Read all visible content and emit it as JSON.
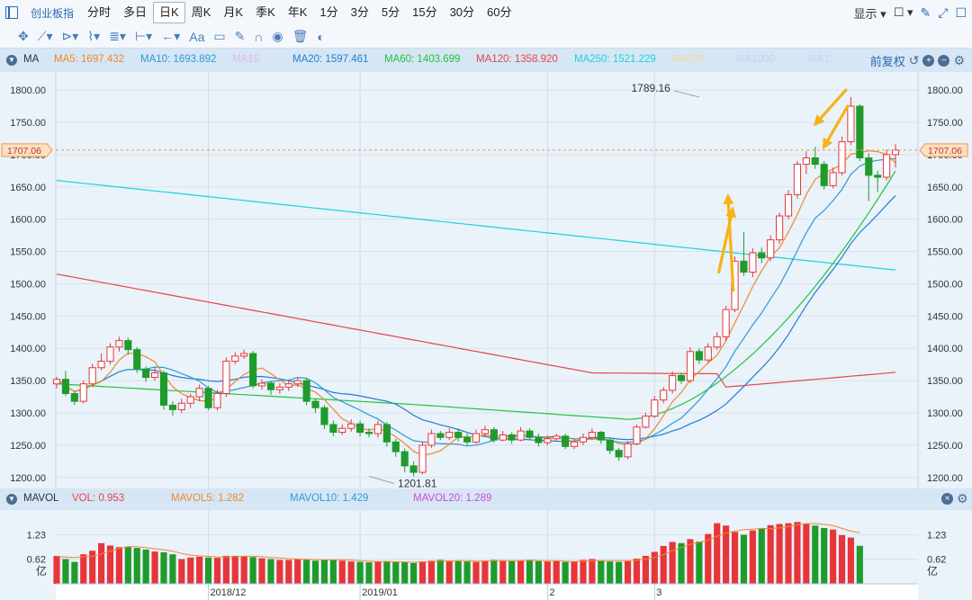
{
  "toolbar": {
    "name": "创业板指",
    "periods": [
      "分时",
      "多日",
      "日K",
      "周K",
      "月K",
      "季K",
      "年K",
      "1分",
      "3分",
      "5分",
      "15分",
      "30分",
      "60分"
    ],
    "active_period": "日K",
    "display_label": "显示"
  },
  "draw_tools": [
    "move-icon",
    "line-icon",
    "ray-icon",
    "polyline-icon",
    "fib-icon",
    "range-icon",
    "arrow-icon",
    "text-icon",
    "comment-icon",
    "pen-icon",
    "magnet-icon",
    "eye-icon",
    "trash-icon",
    "link-icon"
  ],
  "ma_legend": {
    "title": "MA",
    "items": [
      {
        "label": "MA5: 1697.432",
        "color": "#f0882c"
      },
      {
        "label": "MA10: 1693.892",
        "color": "#2c9bd2"
      },
      {
        "label": "MA15:",
        "color": "#e2b5f0"
      },
      {
        "label": "MA20: 1597.461",
        "color": "#1e7fd0"
      },
      {
        "label": "MA60: 1403.699",
        "color": "#22c43a"
      },
      {
        "label": "MA120: 1358.920",
        "color": "#e84545"
      },
      {
        "label": "MA250: 1521.229",
        "color": "#19d3da"
      },
      {
        "label": "MA500:",
        "color": "#f3d7a3"
      },
      {
        "label": "MA1000:",
        "color": "#c9d2f2"
      },
      {
        "label": "MA1:",
        "color": "#c9d2f2"
      }
    ],
    "adjust_label": "前复权"
  },
  "vol_legend": {
    "title": "MAVOL",
    "items": [
      {
        "label": "VOL: 0.953",
        "color": "#e84545"
      },
      {
        "label": "MAVOL5: 1.282",
        "color": "#f0882c"
      },
      {
        "label": "MAVOL10: 1.429",
        "color": "#2c9bd2"
      },
      {
        "label": "MAVOL20: 1.289",
        "color": "#d04ad0"
      }
    ]
  },
  "chart_data": {
    "type": "candlestick",
    "y_ticks": [
      1800.0,
      1750.0,
      1700.0,
      1650.0,
      1600.0,
      1550.0,
      1500.0,
      1450.0,
      1400.0,
      1350.0,
      1300.0,
      1250.0,
      1200.0
    ],
    "ylim": [
      1183,
      1828
    ],
    "current_price": "1707.06",
    "annotations": [
      {
        "text": "1789.16",
        "value": 1789.16,
        "index": 72
      },
      {
        "text": "1201.81",
        "value": 1201.81,
        "index": 35
      }
    ],
    "x_labels": [
      {
        "label": "2018/12",
        "index": 17
      },
      {
        "label": "2019/01",
        "index": 34
      },
      {
        "label": "2",
        "index": 55
      },
      {
        "label": "3",
        "index": 67
      }
    ],
    "candles": [
      [
        1345,
        1352,
        1356,
        1338
      ],
      [
        1352,
        1330,
        1365,
        1326
      ],
      [
        1330,
        1318,
        1334,
        1312
      ],
      [
        1318,
        1345,
        1350,
        1315
      ],
      [
        1345,
        1370,
        1376,
        1340
      ],
      [
        1370,
        1380,
        1392,
        1366
      ],
      [
        1380,
        1402,
        1408,
        1375
      ],
      [
        1402,
        1412,
        1418,
        1395
      ],
      [
        1412,
        1398,
        1416,
        1390
      ],
      [
        1398,
        1368,
        1402,
        1362
      ],
      [
        1368,
        1355,
        1372,
        1348
      ],
      [
        1355,
        1362,
        1370,
        1350
      ],
      [
        1362,
        1312,
        1365,
        1305
      ],
      [
        1312,
        1305,
        1318,
        1296
      ],
      [
        1305,
        1315,
        1322,
        1300
      ],
      [
        1315,
        1325,
        1330,
        1308
      ],
      [
        1325,
        1338,
        1344,
        1318
      ],
      [
        1338,
        1308,
        1342,
        1304
      ],
      [
        1308,
        1330,
        1336,
        1304
      ],
      [
        1330,
        1380,
        1386,
        1325
      ],
      [
        1380,
        1388,
        1394,
        1375
      ],
      [
        1388,
        1392,
        1398,
        1384
      ],
      [
        1392,
        1342,
        1396,
        1338
      ],
      [
        1342,
        1346,
        1352,
        1336
      ],
      [
        1346,
        1336,
        1350,
        1328
      ],
      [
        1336,
        1340,
        1346,
        1330
      ],
      [
        1340,
        1345,
        1350,
        1334
      ],
      [
        1345,
        1350,
        1355,
        1340
      ],
      [
        1350,
        1318,
        1354,
        1312
      ],
      [
        1318,
        1308,
        1322,
        1300
      ],
      [
        1308,
        1282,
        1312,
        1275
      ],
      [
        1282,
        1270,
        1288,
        1264
      ],
      [
        1270,
        1276,
        1282,
        1266
      ],
      [
        1276,
        1283,
        1290,
        1271
      ],
      [
        1283,
        1270,
        1288,
        1264
      ],
      [
        1270,
        1268,
        1276,
        1262
      ],
      [
        1268,
        1282,
        1288,
        1262
      ],
      [
        1282,
        1255,
        1286,
        1248
      ],
      [
        1255,
        1240,
        1260,
        1232
      ],
      [
        1240,
        1218,
        1245,
        1208
      ],
      [
        1218,
        1208,
        1225,
        1201.81
      ],
      [
        1208,
        1250,
        1256,
        1205
      ],
      [
        1250,
        1268,
        1274,
        1246
      ],
      [
        1268,
        1262,
        1272,
        1258
      ],
      [
        1262,
        1270,
        1276,
        1258
      ],
      [
        1270,
        1262,
        1276,
        1256
      ],
      [
        1262,
        1255,
        1268,
        1250
      ],
      [
        1255,
        1268,
        1274,
        1252
      ],
      [
        1268,
        1274,
        1280,
        1264
      ],
      [
        1274,
        1258,
        1278,
        1254
      ],
      [
        1258,
        1266,
        1272,
        1256
      ],
      [
        1266,
        1258,
        1270,
        1252
      ],
      [
        1258,
        1272,
        1278,
        1256
      ],
      [
        1272,
        1262,
        1276,
        1258
      ],
      [
        1262,
        1254,
        1268,
        1248
      ],
      [
        1254,
        1260,
        1265,
        1250
      ],
      [
        1260,
        1264,
        1268,
        1256
      ],
      [
        1264,
        1248,
        1268,
        1244
      ],
      [
        1248,
        1255,
        1260,
        1244
      ],
      [
        1255,
        1262,
        1268,
        1250
      ],
      [
        1262,
        1270,
        1276,
        1258
      ],
      [
        1270,
        1258,
        1272,
        1252
      ],
      [
        1258,
        1242,
        1262,
        1236
      ],
      [
        1242,
        1232,
        1246,
        1226
      ],
      [
        1232,
        1252,
        1256,
        1228
      ],
      [
        1252,
        1278,
        1282,
        1250
      ],
      [
        1278,
        1295,
        1300,
        1276
      ],
      [
        1295,
        1320,
        1326,
        1292
      ],
      [
        1320,
        1335,
        1340,
        1315
      ],
      [
        1335,
        1358,
        1364,
        1330
      ],
      [
        1358,
        1350,
        1362,
        1345
      ],
      [
        1350,
        1395,
        1402,
        1346
      ],
      [
        1395,
        1382,
        1400,
        1376
      ],
      [
        1382,
        1402,
        1408,
        1378
      ],
      [
        1402,
        1418,
        1425,
        1398
      ],
      [
        1418,
        1460,
        1466,
        1412
      ],
      [
        1460,
        1535,
        1542,
        1456
      ],
      [
        1535,
        1518,
        1580,
        1512
      ],
      [
        1518,
        1548,
        1555,
        1510
      ],
      [
        1548,
        1540,
        1556,
        1532
      ],
      [
        1540,
        1568,
        1575,
        1535
      ],
      [
        1568,
        1605,
        1610,
        1562
      ],
      [
        1605,
        1638,
        1645,
        1600
      ],
      [
        1638,
        1685,
        1690,
        1632
      ],
      [
        1685,
        1695,
        1705,
        1670
      ],
      [
        1695,
        1685,
        1712,
        1678
      ],
      [
        1685,
        1652,
        1690,
        1646
      ],
      [
        1652,
        1672,
        1680,
        1648
      ],
      [
        1672,
        1720,
        1728,
        1668
      ],
      [
        1720,
        1775,
        1789.16,
        1715
      ],
      [
        1775,
        1695,
        1778,
        1690
      ],
      [
        1695,
        1668,
        1702,
        1628
      ],
      [
        1668,
        1665,
        1675,
        1642
      ],
      [
        1665,
        1700,
        1708,
        1660
      ],
      [
        1700,
        1707,
        1716,
        1680
      ]
    ],
    "volume": {
      "y_ticks": [
        "1.23",
        "0.62"
      ],
      "unit": "亿",
      "ylim": [
        0,
        1.85
      ],
      "values": [
        0.7,
        0.62,
        0.55,
        0.74,
        0.83,
        1.02,
        0.96,
        0.92,
        0.93,
        0.9,
        0.86,
        0.81,
        0.79,
        0.74,
        0.62,
        0.66,
        0.68,
        0.66,
        0.65,
        0.7,
        0.7,
        0.69,
        0.67,
        0.64,
        0.62,
        0.6,
        0.6,
        0.62,
        0.62,
        0.58,
        0.6,
        0.61,
        0.58,
        0.56,
        0.55,
        0.54,
        0.56,
        0.57,
        0.55,
        0.54,
        0.52,
        0.56,
        0.58,
        0.6,
        0.58,
        0.57,
        0.56,
        0.55,
        0.58,
        0.6,
        0.59,
        0.57,
        0.59,
        0.6,
        0.57,
        0.56,
        0.57,
        0.55,
        0.56,
        0.6,
        0.62,
        0.58,
        0.56,
        0.55,
        0.57,
        0.63,
        0.7,
        0.8,
        0.95,
        1.05,
        1.02,
        1.12,
        1.06,
        1.25,
        1.52,
        1.46,
        1.3,
        1.23,
        1.34,
        1.38,
        1.47,
        1.5,
        1.52,
        1.55,
        1.5,
        1.46,
        1.4,
        1.36,
        1.22,
        1.16,
        0.953
      ],
      "mavol5": [
        0.68,
        0.67,
        0.66,
        0.68,
        0.69,
        0.75,
        0.82,
        0.89,
        0.93,
        0.93,
        0.91,
        0.88,
        0.85,
        0.82,
        0.76,
        0.72,
        0.7,
        0.69,
        0.67,
        0.67,
        0.68,
        0.69,
        0.69,
        0.68,
        0.66,
        0.65,
        0.63,
        0.62,
        0.61,
        0.61,
        0.6,
        0.6,
        0.6,
        0.59,
        0.58,
        0.57,
        0.56,
        0.56,
        0.55,
        0.55,
        0.54,
        0.55,
        0.56,
        0.57,
        0.57,
        0.58,
        0.58,
        0.57,
        0.57,
        0.58,
        0.58,
        0.58,
        0.58,
        0.59,
        0.58,
        0.58,
        0.58,
        0.57,
        0.56,
        0.57,
        0.58,
        0.58,
        0.58,
        0.58,
        0.58,
        0.59,
        0.62,
        0.66,
        0.73,
        0.83,
        0.91,
        0.99,
        1.04,
        1.1,
        1.19,
        1.28,
        1.32,
        1.36,
        1.37,
        1.39,
        1.38,
        1.4,
        1.44,
        1.48,
        1.51,
        1.51,
        1.49,
        1.46,
        1.39,
        1.32,
        1.28
      ]
    }
  }
}
